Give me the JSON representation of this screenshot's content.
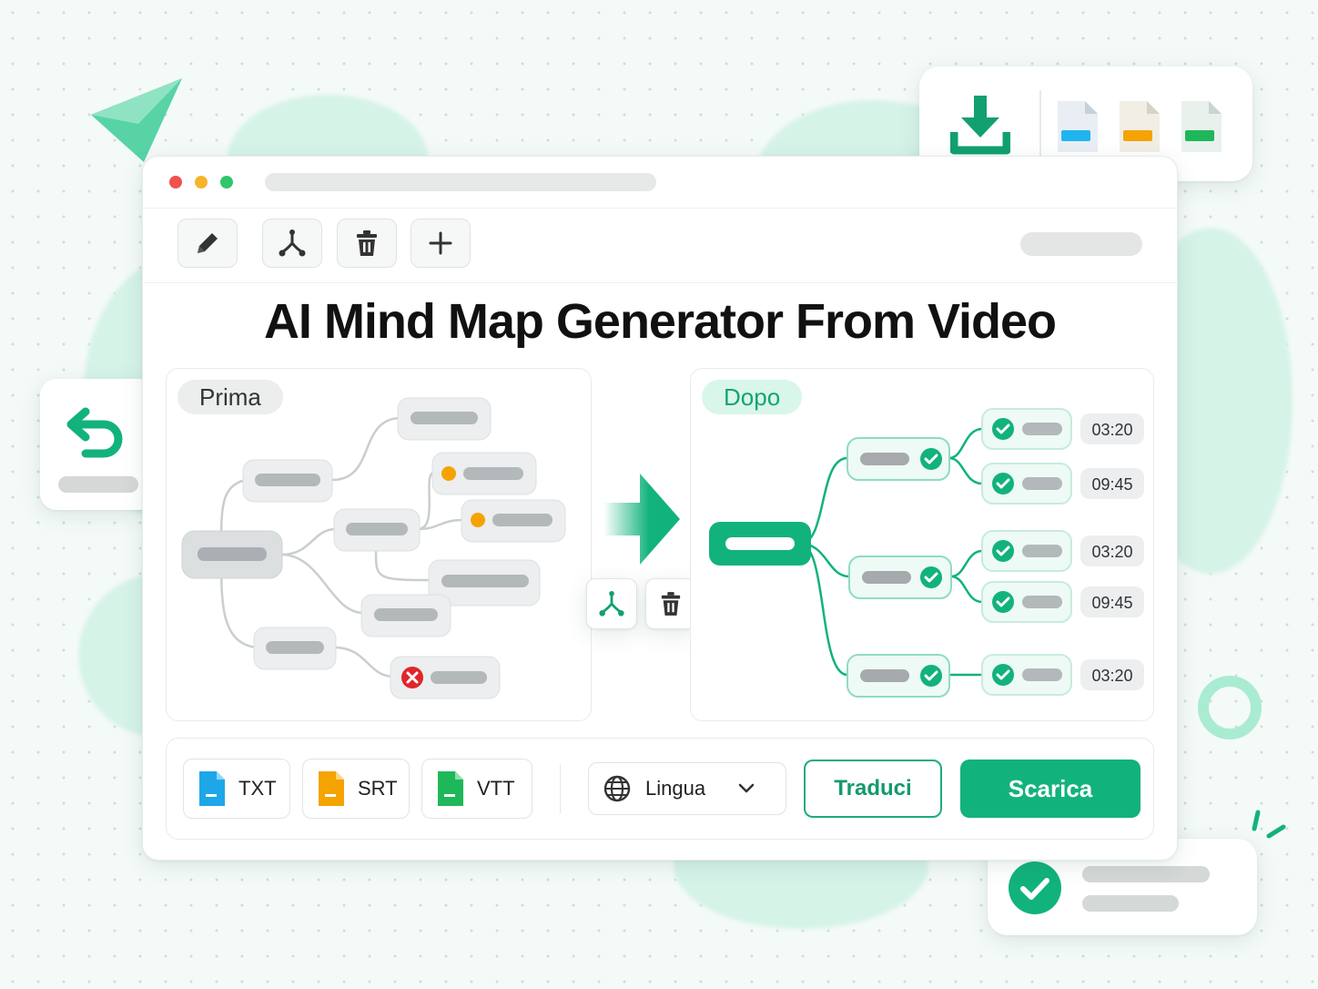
{
  "title": "AI Mind Map Generator From Video",
  "toolbar": {
    "buttons": [
      {
        "name": "edit-button",
        "icon": "pencil-icon"
      },
      {
        "name": "branch-button",
        "icon": "branch-icon"
      },
      {
        "name": "delete-button",
        "icon": "trash-icon"
      },
      {
        "name": "add-button",
        "icon": "plus-icon"
      }
    ]
  },
  "before": {
    "label": "Prima"
  },
  "after": {
    "label": "Dopo",
    "timestamps": [
      "03:20",
      "09:45",
      "03:20",
      "09:45",
      "03:20"
    ]
  },
  "export": {
    "formats": [
      {
        "label": "TXT",
        "color": "#1ea7e8"
      },
      {
        "label": "SRT",
        "color": "#f5a300"
      },
      {
        "label": "VTT",
        "color": "#1eb85a"
      }
    ],
    "language_label": "Lingua",
    "translate_label": "Traduci",
    "download_label": "Scarica"
  },
  "colors": {
    "accent": "#12b27c",
    "accent_light": "#d9f6ea",
    "error": "#e0262b",
    "warning": "#f5a300"
  }
}
